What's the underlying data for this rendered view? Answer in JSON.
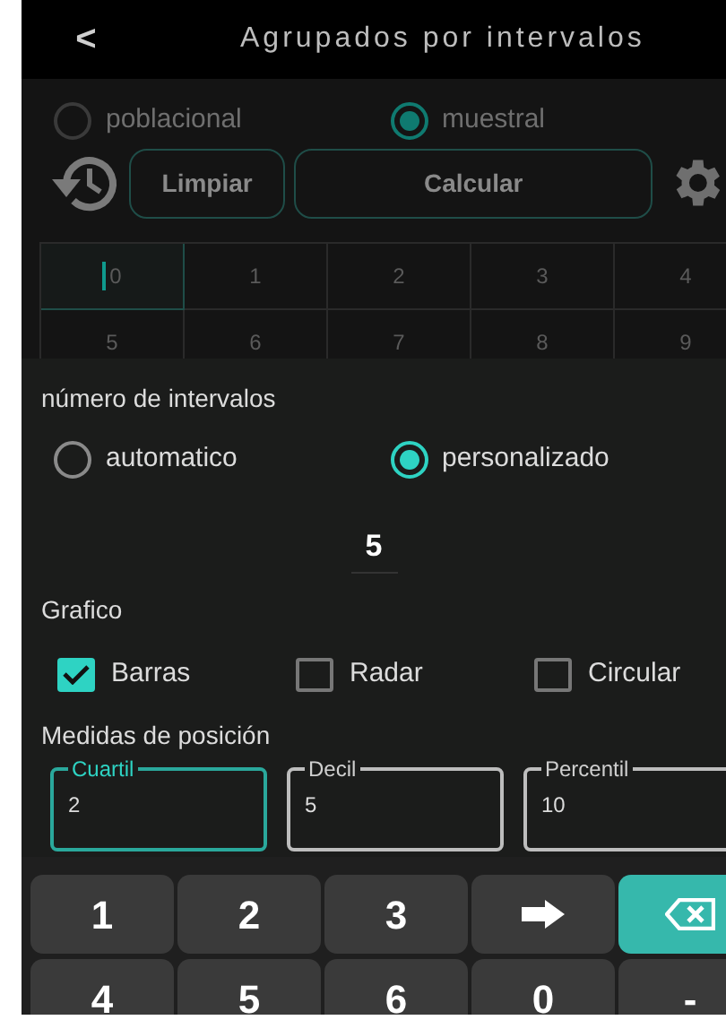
{
  "header": {
    "back": "<",
    "title": "Agrupados por intervalos"
  },
  "type_options": [
    {
      "label": "poblacional",
      "selected": false
    },
    {
      "label": "muestral",
      "selected": true
    }
  ],
  "buttons": [
    "Limpiar",
    "Calcular"
  ],
  "data_cells": [
    {
      "placeholder": "0",
      "focused": true
    },
    {
      "placeholder": "1",
      "focused": false
    },
    {
      "placeholder": "2",
      "focused": false
    },
    {
      "placeholder": "3",
      "focused": false
    },
    {
      "placeholder": "4",
      "focused": false
    },
    {
      "placeholder": "5",
      "focused": false
    },
    {
      "placeholder": "6",
      "focused": false
    },
    {
      "placeholder": "7",
      "focused": false
    },
    {
      "placeholder": "8",
      "focused": false
    },
    {
      "placeholder": "9",
      "focused": false
    }
  ],
  "sheet": {
    "intervals_label": "número de intervalos",
    "interval_options": [
      {
        "label": "automatico",
        "selected": false
      },
      {
        "label": "personalizado",
        "selected": true
      }
    ],
    "interval_count": "5",
    "chart_label": "Grafico",
    "chart_options": [
      {
        "label": "Barras",
        "checked": true
      },
      {
        "label": "Radar",
        "checked": false
      },
      {
        "label": "Circular",
        "checked": false
      }
    ],
    "positions_label": "Medidas de posición",
    "position_fields": [
      {
        "label": "Cuartil",
        "value": "2",
        "focused": true
      },
      {
        "label": "Decil",
        "value": "5",
        "focused": false
      },
      {
        "label": "Percentil",
        "value": "10",
        "focused": false
      }
    ]
  },
  "keyboard": [
    {
      "kind": "char",
      "label": "1"
    },
    {
      "kind": "char",
      "label": "2"
    },
    {
      "kind": "char",
      "label": "3"
    },
    {
      "kind": "next"
    },
    {
      "kind": "backspace"
    },
    {
      "kind": "char",
      "label": "4"
    },
    {
      "kind": "char",
      "label": "5"
    },
    {
      "kind": "char",
      "label": "6"
    },
    {
      "kind": "char",
      "label": "0"
    },
    {
      "kind": "char",
      "label": "-"
    }
  ]
}
